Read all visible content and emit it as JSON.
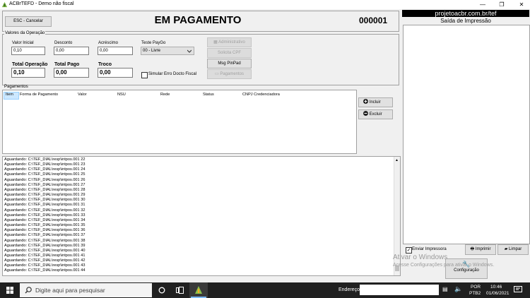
{
  "window": {
    "title": "ACBrTEFD - Demo não fiscal",
    "minimize": "—",
    "maximize": "❐",
    "close": "✕"
  },
  "header": {
    "esc_button": "ESC - Cancelar",
    "status_title": "EM PAGAMENTO",
    "counter": "000001"
  },
  "valores": {
    "group_label": "Valores da Operação",
    "valor_inicial": {
      "label": "Valor Inicial",
      "value": "0,10"
    },
    "desconto": {
      "label": "Desconto",
      "value": "0,00"
    },
    "acrescimo": {
      "label": "Acréscimo",
      "value": "0,00"
    },
    "teste_paygo": {
      "label": "Teste PayGo",
      "value": "00 - Livre"
    },
    "total_operacao": {
      "label": "Total Operação",
      "value": "0,10"
    },
    "total_pago": {
      "label": "Total Pago",
      "value": "0,00"
    },
    "troco": {
      "label": "Troco",
      "value": "0,00"
    },
    "simular_erro": "Simular Erro Docto Fiscal"
  },
  "side_buttons": {
    "administrativo": "Administrativo",
    "solicita_cpf": "Solicita CPF",
    "msg_pinpad": "Msg PinPad",
    "pagamentos": "Pagamentos"
  },
  "pagamentos": {
    "group_label": "Pagamentos",
    "columns": [
      "Item",
      "Forma de Pagamento",
      "Valor",
      "NSU",
      "Rede",
      "Status",
      "CNPJ Credenciadora"
    ],
    "incluir": "Incluir",
    "excluir": "Excluir"
  },
  "log_lines": [
    "Aguardando: C:\\TEF_DIAL\\resp\\intpos.001 22",
    "Aguardando: C:\\TEF_DIAL\\resp\\intpos.001 23",
    "Aguardando: C:\\TEF_DIAL\\resp\\intpos.001 24",
    "Aguardando: C:\\TEF_DIAL\\resp\\intpos.001 25",
    "Aguardando: C:\\TEF_DIAL\\resp\\intpos.001 26",
    "Aguardando: C:\\TEF_DIAL\\resp\\intpos.001 27",
    "Aguardando: C:\\TEF_DIAL\\resp\\intpos.001 28",
    "Aguardando: C:\\TEF_DIAL\\resp\\intpos.001 29",
    "Aguardando: C:\\TEF_DIAL\\resp\\intpos.001 30",
    "Aguardando: C:\\TEF_DIAL\\resp\\intpos.001 31",
    "Aguardando: C:\\TEF_DIAL\\resp\\intpos.001 32",
    "Aguardando: C:\\TEF_DIAL\\resp\\intpos.001 33",
    "Aguardando: C:\\TEF_DIAL\\resp\\intpos.001 34",
    "Aguardando: C:\\TEF_DIAL\\resp\\intpos.001 35",
    "Aguardando: C:\\TEF_DIAL\\resp\\intpos.001 36",
    "Aguardando: C:\\TEF_DIAL\\resp\\intpos.001 37",
    "Aguardando: C:\\TEF_DIAL\\resp\\intpos.001 38",
    "Aguardando: C:\\TEF_DIAL\\resp\\intpos.001 39",
    "Aguardando: C:\\TEF_DIAL\\resp\\intpos.001 40",
    "Aguardando: C:\\TEF_DIAL\\resp\\intpos.001 41",
    "Aguardando: C:\\TEF_DIAL\\resp\\intpos.001 42",
    "Aguardando: C:\\TEF_DIAL\\resp\\intpos.001 43",
    "Aguardando: C:\\TEF_DIAL\\resp\\intpos.001 44"
  ],
  "right_panel": {
    "banner": "projetoacbr.com.br/tef",
    "saida_title": "Saída de Impressão",
    "enviar_impressora": "Enviar Impressora",
    "imprimir": "Imprimir",
    "limpar": "Limpar",
    "configuracao": "Configuração"
  },
  "watermark": {
    "line1": "Ativar o Windows",
    "line2": "Acesse Configurações para ativar o Windows."
  },
  "taskbar": {
    "search_placeholder": "Digite aqui para pesquisar",
    "endereco_label": "Endereço",
    "lang1": "POR",
    "lang2": "PTB2",
    "time": "10:46",
    "date": "01/06/2021"
  },
  "colors": {
    "banner_bg": "#000000",
    "banner_fg": "#ffffff",
    "taskbar_bg": "#202020",
    "selected_header": "#cce8ff"
  }
}
